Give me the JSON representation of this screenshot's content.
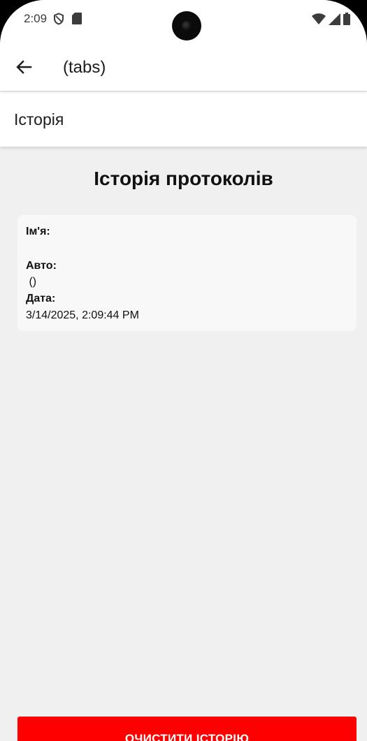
{
  "status_bar": {
    "time": "2:09",
    "left_icons": [
      "shield-icon",
      "sd-card-icon"
    ],
    "right_icons": [
      "wifi-icon",
      "cellular-signal-icon",
      "battery-icon"
    ]
  },
  "app_bar": {
    "back_icon": "arrow-left-icon",
    "title": "(tabs)"
  },
  "tab": {
    "title": "Історія"
  },
  "page": {
    "heading": "Історія протоколів"
  },
  "history": [
    {
      "name_label": "Ім'я:",
      "name_value": "",
      "car_label": "Авто:",
      "car_value": " ()",
      "date_label": "Дата:",
      "date_value": "3/14/2025, 2:09:44 PM"
    }
  ],
  "actions": {
    "clear_label": "ОЧИСТИТИ ІСТОРІЮ",
    "clear_color": "#ff0000"
  }
}
